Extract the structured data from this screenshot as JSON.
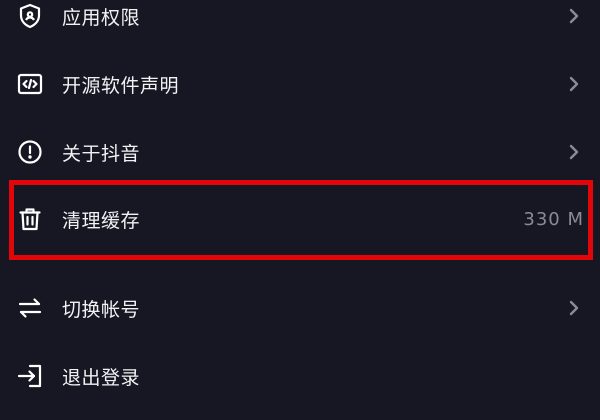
{
  "colors": {
    "background": "#161722",
    "text": "#f2f2f4",
    "secondary_text": "#8a8b95",
    "chevron": "#8a8b95",
    "highlight": "#e0060a"
  },
  "menu": {
    "items": [
      {
        "label": "应用权限",
        "icon": "shield-icon",
        "has_chevron": true
      },
      {
        "label": "开源软件声明",
        "icon": "code-icon",
        "has_chevron": true
      },
      {
        "label": "关于抖音",
        "icon": "info-icon",
        "has_chevron": true
      },
      {
        "label": "清理缓存",
        "icon": "trash-icon",
        "value": "330 M",
        "has_chevron": false
      },
      {
        "label": "切换帐号",
        "icon": "switch-icon",
        "has_chevron": true
      },
      {
        "label": "退出登录",
        "icon": "logout-icon",
        "has_chevron": false
      }
    ]
  }
}
